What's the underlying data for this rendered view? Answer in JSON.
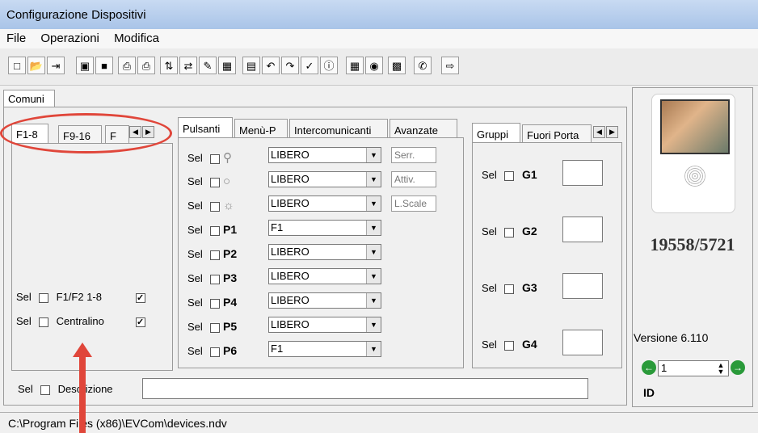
{
  "window": {
    "title": "Configurazione Dispositivi"
  },
  "menu": [
    "File",
    "Operazioni",
    "Modifica"
  ],
  "toolbar_icons": [
    "new-icon",
    "open-icon",
    "export-icon",
    "save-icon",
    "copy-icon",
    "print-icon",
    "print-preview-icon",
    "sort-icon",
    "import-icon",
    "edit-icon",
    "compare-icon",
    "paste-icon",
    "undo-icon",
    "redo-icon",
    "check-icon",
    "info-icon",
    "calendar-icon",
    "network-icon",
    "archive-icon",
    "tool-icon",
    "exit-icon"
  ],
  "tabs": {
    "comuni": "Comuni",
    "left": [
      "F1-8",
      "F9-16",
      "F"
    ],
    "middle": [
      "Pulsanti",
      "Menù-P",
      "Intercomunicanti",
      "Avanzate"
    ],
    "right": [
      "Gruppi",
      "Fuori Porta"
    ]
  },
  "sel_label": "Sel",
  "left_panel": {
    "items": [
      {
        "label": "F1/F2 1-8",
        "checked": true
      },
      {
        "label": "Centralino",
        "checked": true
      }
    ]
  },
  "pulsanti": {
    "rows": [
      {
        "key": "key-icon",
        "value": "LIBERO",
        "extra": "Serr."
      },
      {
        "key": "bell-icon",
        "value": "LIBERO",
        "extra": "Attiv."
      },
      {
        "key": "light-icon",
        "value": "LIBERO",
        "extra": "L.Scale"
      },
      {
        "key": "P1",
        "value": "F1"
      },
      {
        "key": "P2",
        "value": "LIBERO"
      },
      {
        "key": "P3",
        "value": "LIBERO"
      },
      {
        "key": "P4",
        "value": "LIBERO"
      },
      {
        "key": "P5",
        "value": "LIBERO"
      },
      {
        "key": "P6",
        "value": "F1"
      }
    ]
  },
  "gruppi": [
    "G1",
    "G2",
    "G3",
    "G4"
  ],
  "device": {
    "model": "19558/5721",
    "version": "Versione 6.110",
    "id_value": "1",
    "id_label": "ID"
  },
  "description": {
    "label": "Descrizione",
    "value": ""
  },
  "status_bar": "C:\\Program Files (x86)\\EVCom\\devices.ndv",
  "colors": {
    "annotation": "#e0463a",
    "accent_green": "#2a9a3a"
  }
}
